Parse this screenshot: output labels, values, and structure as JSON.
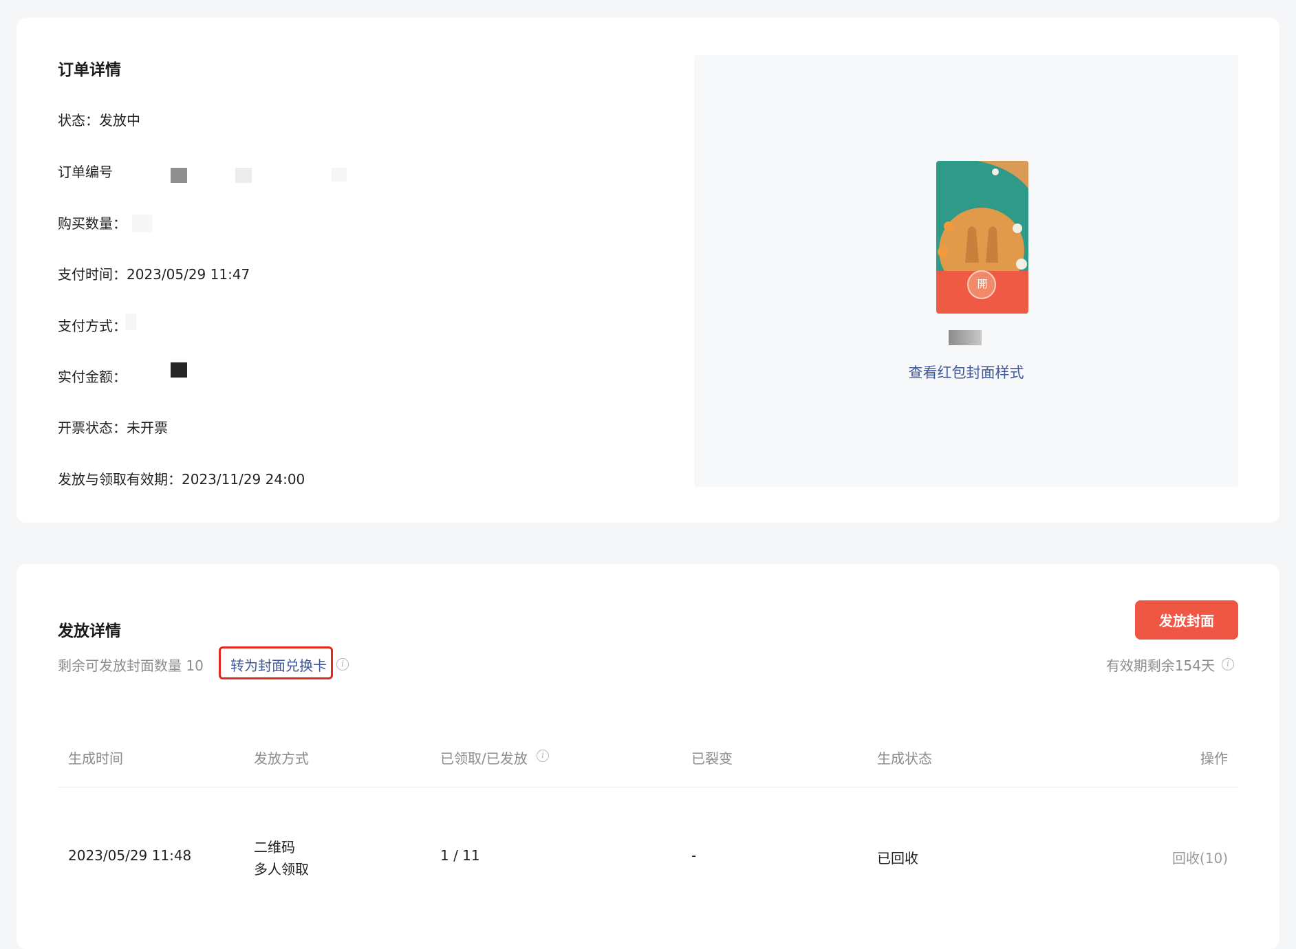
{
  "order": {
    "title": "订单详情",
    "status": "状态：发放中",
    "order_no_label": "订单编号",
    "qty_label": "购买数量：",
    "pay_time": "支付时间：2023/05/29 11:47",
    "pay_method_label": "支付方式：",
    "paid_amount_label": "实付金额：",
    "invoice": "开票状态：未开票",
    "validity": "发放与领取有效期：2023/11/29 24:00",
    "preview_link": "查看红包封面样式",
    "cover_seal": "開"
  },
  "distribution": {
    "title": "发放详情",
    "remaining": "剩余可发放封面数量 10",
    "redeem_link": "转为封面兑换卡",
    "send_button": "发放封面",
    "expiry": "有效期剩余154天",
    "info_glyph": "i",
    "columns": [
      "生成时间",
      "发放方式",
      "已领取/已发放",
      "已裂变",
      "生成状态",
      "操作"
    ],
    "rows": [
      {
        "time": "2023/05/29 11:48",
        "method_line1": "二维码",
        "method_line2": "多人领取",
        "claimed": "1 / 11",
        "fission": "-",
        "status": "已回收",
        "action": "回收(10)"
      }
    ]
  },
  "colors": {
    "accent_red": "#ef5744",
    "link_blue": "#40589a",
    "highlight_box": "#e02a1d"
  }
}
